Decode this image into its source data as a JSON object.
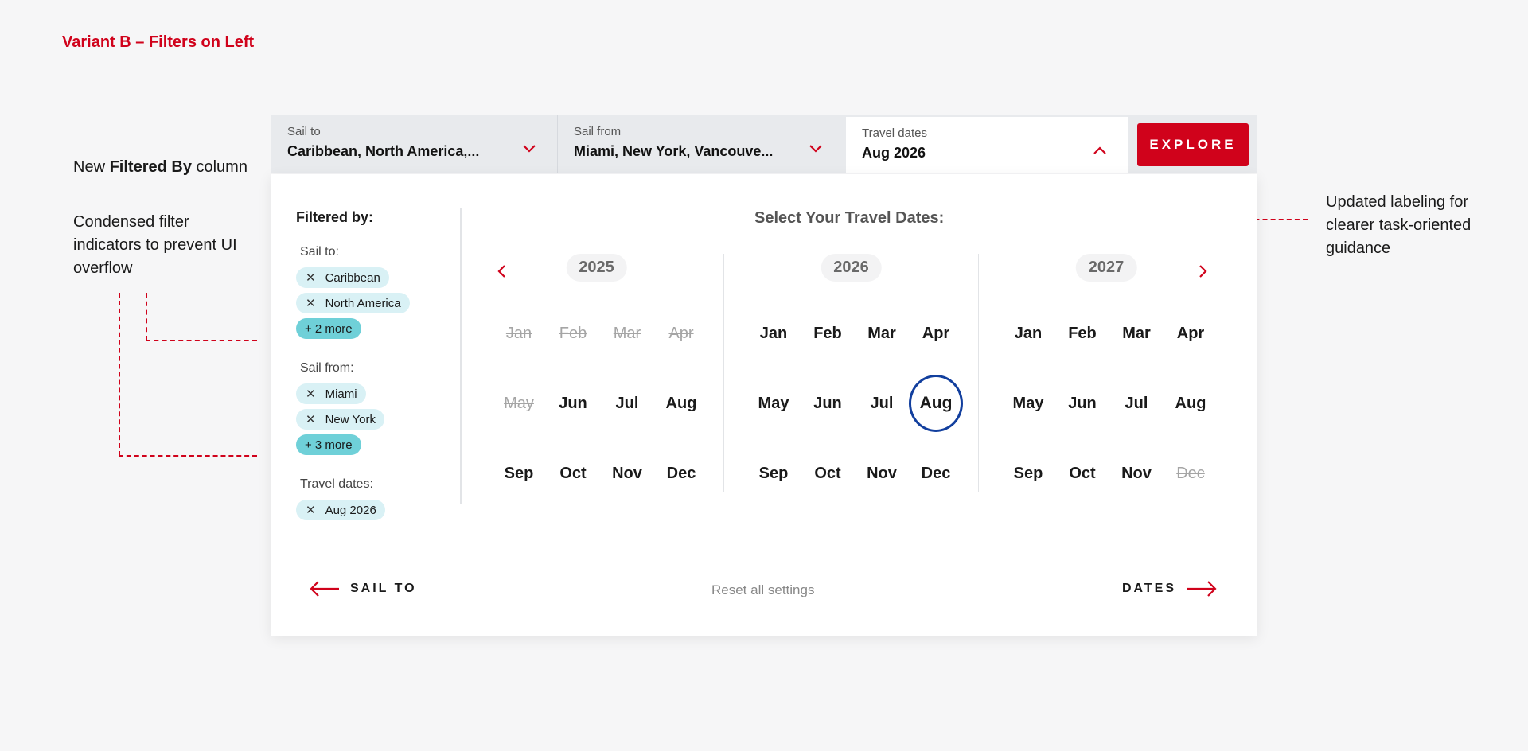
{
  "variant_title": "Variant B – Filters on Left",
  "annotations": {
    "filtered_by_prefix": "New ",
    "filtered_by_bold": "Filtered By",
    "filtered_by_suffix": " column",
    "condensed": "Condensed filter indicators to prevent UI overflow",
    "updated_labeling": "Updated labeling for clearer task-oriented guidance"
  },
  "searchbar": {
    "sail_to": {
      "label": "Sail to",
      "value": "Caribbean, North America,..."
    },
    "sail_from": {
      "label": "Sail from",
      "value": "Miami, New York, Vancouve..."
    },
    "travel_dates": {
      "label": "Travel dates",
      "value": "Aug 2026"
    },
    "explore_label": "EXPLORE"
  },
  "filters": {
    "heading": "Filtered by:",
    "sail_to": {
      "label": "Sail to:",
      "chips": [
        "Caribbean",
        "North America"
      ],
      "more": "+ 2 more"
    },
    "sail_from": {
      "label": "Sail from:",
      "chips": [
        "Miami",
        "New York"
      ],
      "more": "+ 3 more"
    },
    "travel_dates": {
      "label": "Travel dates:",
      "chips": [
        "Aug 2026"
      ]
    }
  },
  "calendar": {
    "title": "Select Your Travel Dates:",
    "years": [
      {
        "year": "2025",
        "months": [
          {
            "name": "Jan",
            "state": "disabled"
          },
          {
            "name": "Feb",
            "state": "disabled"
          },
          {
            "name": "Mar",
            "state": "disabled"
          },
          {
            "name": "Apr",
            "state": "disabled"
          },
          {
            "name": "May",
            "state": "disabled"
          },
          {
            "name": "Jun",
            "state": "available"
          },
          {
            "name": "Jul",
            "state": "available"
          },
          {
            "name": "Aug",
            "state": "available"
          },
          {
            "name": "Sep",
            "state": "available"
          },
          {
            "name": "Oct",
            "state": "available"
          },
          {
            "name": "Nov",
            "state": "available"
          },
          {
            "name": "Dec",
            "state": "available"
          }
        ]
      },
      {
        "year": "2026",
        "months": [
          {
            "name": "Jan",
            "state": "available"
          },
          {
            "name": "Feb",
            "state": "available"
          },
          {
            "name": "Mar",
            "state": "available"
          },
          {
            "name": "Apr",
            "state": "available"
          },
          {
            "name": "May",
            "state": "available"
          },
          {
            "name": "Jun",
            "state": "available"
          },
          {
            "name": "Jul",
            "state": "available"
          },
          {
            "name": "Aug",
            "state": "selected"
          },
          {
            "name": "Sep",
            "state": "available"
          },
          {
            "name": "Oct",
            "state": "available"
          },
          {
            "name": "Nov",
            "state": "available"
          },
          {
            "name": "Dec",
            "state": "available"
          }
        ]
      },
      {
        "year": "2027",
        "months": [
          {
            "name": "Jan",
            "state": "available"
          },
          {
            "name": "Feb",
            "state": "available"
          },
          {
            "name": "Mar",
            "state": "available"
          },
          {
            "name": "Apr",
            "state": "available"
          },
          {
            "name": "May",
            "state": "available"
          },
          {
            "name": "Jun",
            "state": "available"
          },
          {
            "name": "Jul",
            "state": "available"
          },
          {
            "name": "Aug",
            "state": "available"
          },
          {
            "name": "Sep",
            "state": "available"
          },
          {
            "name": "Oct",
            "state": "available"
          },
          {
            "name": "Nov",
            "state": "available"
          },
          {
            "name": "Dec",
            "state": "disabled"
          }
        ]
      }
    ]
  },
  "footer": {
    "back_label": "SAIL TO",
    "reset_label": "Reset all settings",
    "next_label": "DATES"
  },
  "icons": {
    "chevron": "chevron-down-icon",
    "close": "close-icon",
    "arrow_left": "arrow-left-icon",
    "arrow_right": "arrow-right-icon"
  },
  "colors": {
    "accent": "#d0021b",
    "selected_ring": "#123f9e",
    "chip": "#d9f1f5",
    "chip_more": "#6fd0d8"
  }
}
